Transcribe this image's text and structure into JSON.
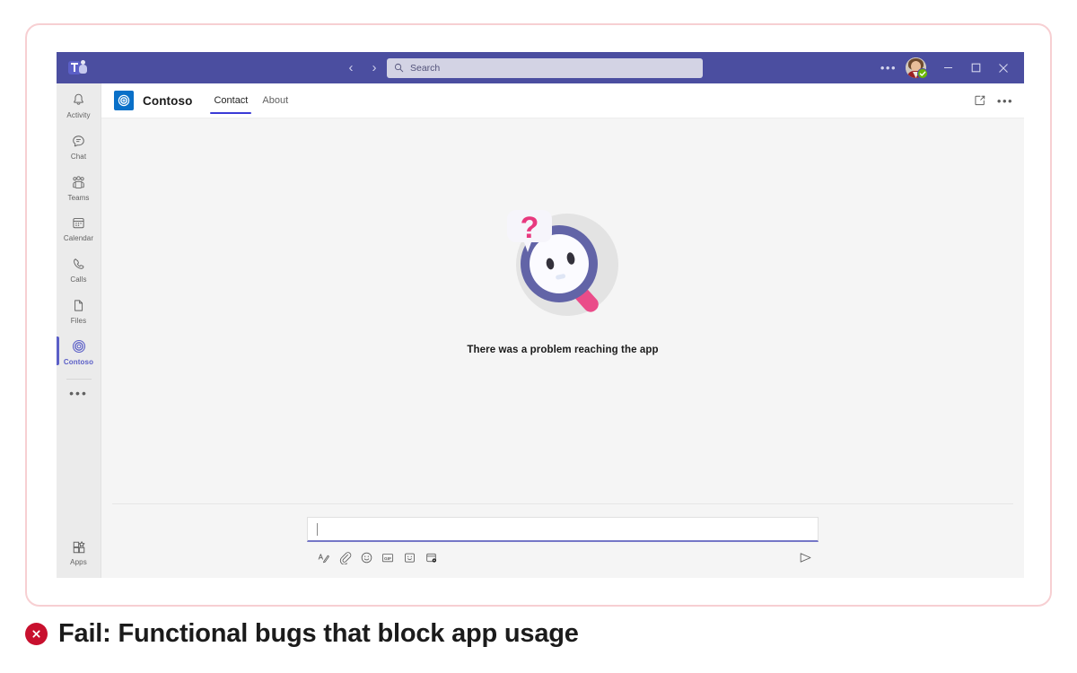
{
  "frame": {
    "border_color": "#f7cfd2"
  },
  "titlebar": {
    "app_logo_name": "microsoft-teams-logo",
    "back_label": "‹",
    "forward_label": "›",
    "search": {
      "placeholder": "Search",
      "value": ""
    },
    "more_label": "•••",
    "minimize_label": "Minimize",
    "maximize_label": "Maximize",
    "close_label": "Close",
    "presence_status": "Available",
    "bg_color": "#4b4ea0"
  },
  "rail": {
    "items": [
      {
        "label": "Activity",
        "icon": "bell-icon",
        "active": false
      },
      {
        "label": "Chat",
        "icon": "chat-icon",
        "active": false
      },
      {
        "label": "Teams",
        "icon": "teams-icon",
        "active": false
      },
      {
        "label": "Calendar",
        "icon": "calendar-icon",
        "active": false
      },
      {
        "label": "Calls",
        "icon": "phone-icon",
        "active": false
      },
      {
        "label": "Files",
        "icon": "file-icon",
        "active": false
      },
      {
        "label": "Contoso",
        "icon": "contoso-icon",
        "active": true
      }
    ],
    "more_label": "•••",
    "bottom": {
      "label": "Apps",
      "icon": "apps-grid-icon"
    },
    "accent_color": "#5b5fc7"
  },
  "app_header": {
    "logo_name": "contoso-logo",
    "logo_color": "#0a70c8",
    "title": "Contoso",
    "tabs": [
      {
        "label": "Contact",
        "active": true
      },
      {
        "label": "About",
        "active": false
      }
    ],
    "popout_label": "Open in new window",
    "more_label": "•••",
    "tab_underline_color": "#3a3ad6"
  },
  "empty_state": {
    "illustration_name": "magnifying-glass-question-illustration",
    "message": "There was a problem reaching the app",
    "colors": {
      "circle": "#e3e3e3",
      "glass_ring": "#6264a7",
      "handle": "#ea4c89",
      "question": "#e8397f"
    }
  },
  "compose": {
    "value": "",
    "placeholder": "",
    "toolbar": [
      {
        "name": "format-icon",
        "label": "Format"
      },
      {
        "name": "attach-icon",
        "label": "Attach"
      },
      {
        "name": "emoji-icon",
        "label": "Emoji"
      },
      {
        "name": "gif-icon",
        "label": "GIF"
      },
      {
        "name": "sticker-icon",
        "label": "Sticker"
      },
      {
        "name": "schedule-icon",
        "label": "Schedule"
      }
    ],
    "send_label": "Send"
  },
  "caption": {
    "icon_name": "fail-x-icon",
    "icon_color": "#c8102e",
    "text": "Fail: Functional bugs that block app usage"
  }
}
